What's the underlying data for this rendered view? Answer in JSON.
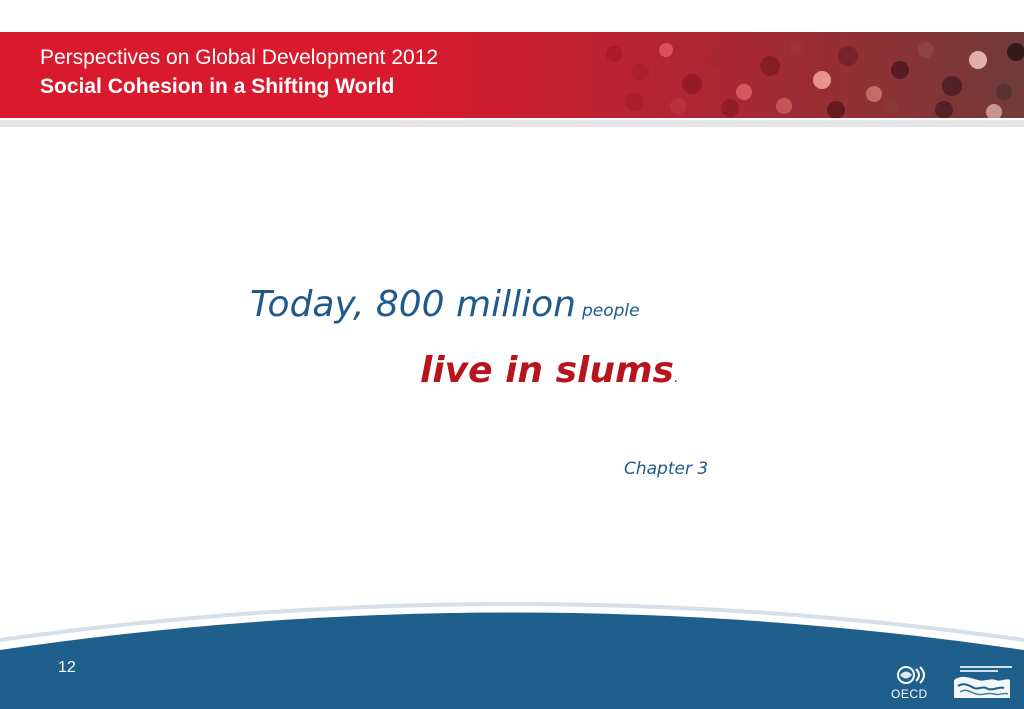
{
  "header": {
    "title": "Perspectives on Global Development 2012",
    "subtitle": "Social Cohesion in a Shifting World"
  },
  "quote": {
    "line1_main": "Today, 800 million",
    "line1_small": "people",
    "line2_main": "live in slums",
    "line2_punct": ".",
    "reference": "Chapter 3"
  },
  "footer": {
    "page_number": "12",
    "oecd_label": "OECD"
  },
  "colors": {
    "header_red": "#d9192e",
    "blue_text": "#1f5a8a",
    "red_text": "#b8141d",
    "footer_blue": "#1f5f8b"
  },
  "icons": [
    "crowd-photo",
    "oecd-logo-icon",
    "development-centre-logo-icon"
  ]
}
